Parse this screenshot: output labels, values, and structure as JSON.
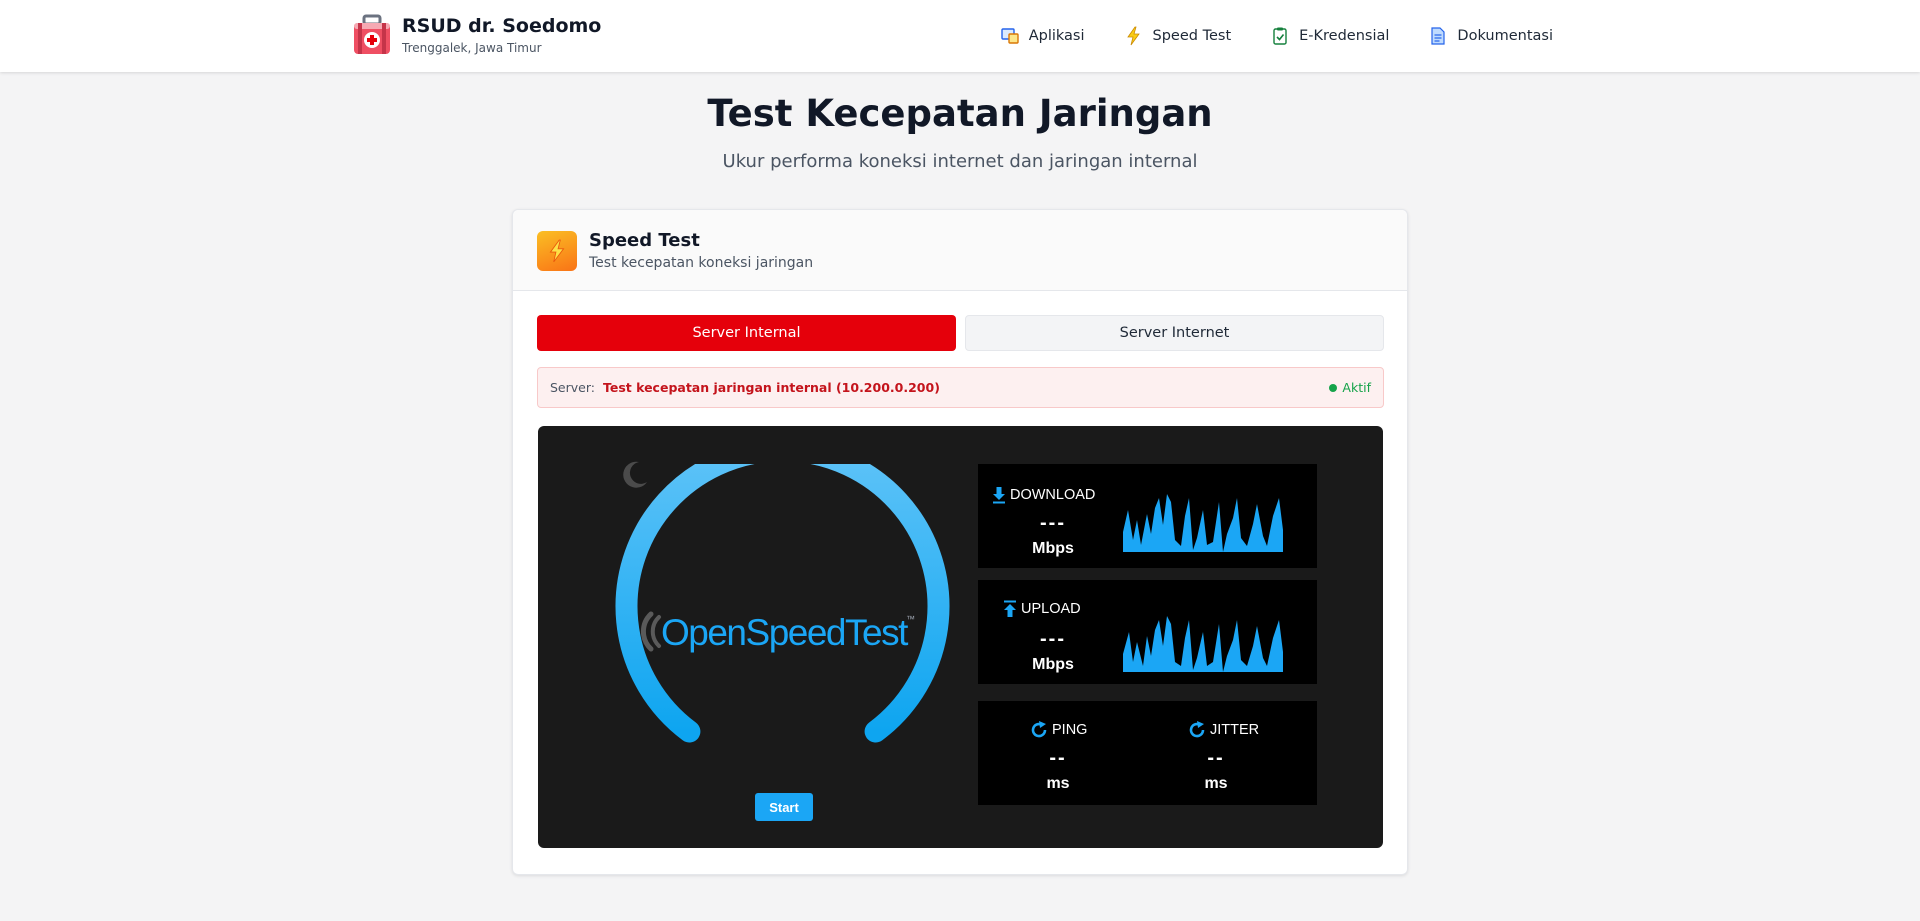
{
  "header": {
    "brand_title": "RSUD dr. Soedomo",
    "brand_subtitle": "Trenggalek, Jawa Timur",
    "nav": [
      {
        "label": "Aplikasi",
        "icon": "apps-icon"
      },
      {
        "label": "Speed Test",
        "icon": "lightning-icon"
      },
      {
        "label": "E-Kredensial",
        "icon": "clipboard-check-icon"
      },
      {
        "label": "Dokumentasi",
        "icon": "document-icon"
      }
    ]
  },
  "page": {
    "title": "Test Kecepatan Jaringan",
    "subtitle": "Ukur performa koneksi internet dan jaringan internal"
  },
  "card": {
    "title": "Speed Test",
    "subtitle": "Test kecepatan koneksi jaringan",
    "tabs": [
      {
        "label": "Server Internal",
        "active": true
      },
      {
        "label": "Server Internet",
        "active": false
      }
    ],
    "server": {
      "label": "Server:",
      "value": "Test kecepatan jaringan internal (10.200.0.200)",
      "status": "Aktif"
    }
  },
  "speedtest": {
    "logo_text": "OpenSpeedTest",
    "trademark": "™",
    "start_label": "Start",
    "download": {
      "label": "DOWNLOAD",
      "value": "---",
      "unit": "Mbps"
    },
    "upload": {
      "label": "UPLOAD",
      "value": "---",
      "unit": "Mbps"
    },
    "ping": {
      "label": "PING",
      "value": "--",
      "unit": "ms"
    },
    "jitter": {
      "label": "JITTER",
      "value": "--",
      "unit": "ms"
    }
  },
  "colors": {
    "accent_red": "#e5000b",
    "status_green": "#16a34a",
    "gauge_blue": "#1ba6f5",
    "panel_bg": "#1a1a1a"
  }
}
